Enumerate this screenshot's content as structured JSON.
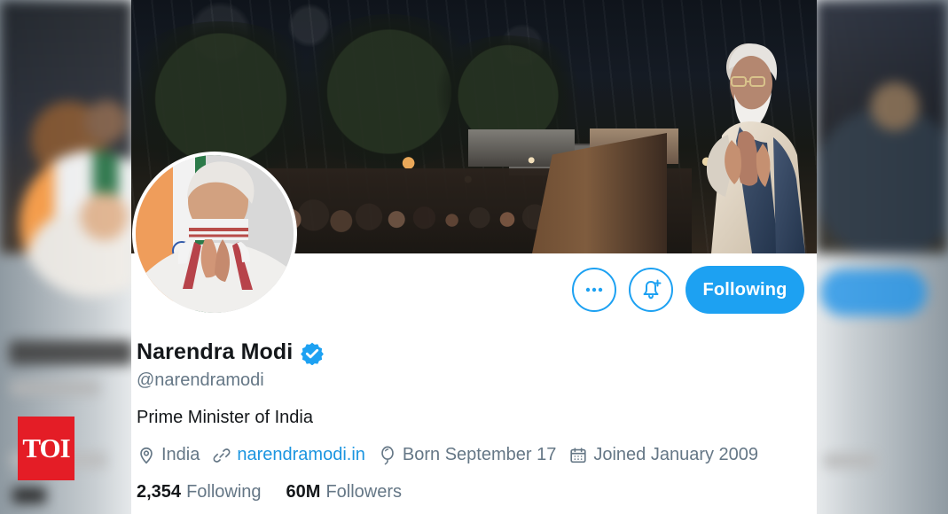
{
  "brand": {
    "badge_text": "TOI",
    "badge_color": "#E41D26"
  },
  "profile": {
    "name": "Narendra Modi",
    "handle": "@narendramodi",
    "bio": "Prime Minister of India",
    "location": "India",
    "website": "narendramodi.in",
    "birthday": "Born September 17",
    "joined": "Joined January 2009",
    "following_count": "2,354",
    "following_label": "Following",
    "followers_count": "60M",
    "followers_label": "Followers"
  },
  "actions": {
    "more_icon": "more-options-icon",
    "notify_icon": "notification-bell-plus-icon",
    "follow_button_label": "Following"
  },
  "icons": {
    "location": "location-pin-icon",
    "website": "link-icon",
    "birthday": "balloon-icon",
    "joined": "calendar-icon",
    "verified": "verified-check-icon"
  },
  "colors": {
    "accent": "#1DA1F2",
    "link": "#1B95E0",
    "secondary_text": "#657786",
    "primary_text": "#14171A"
  }
}
